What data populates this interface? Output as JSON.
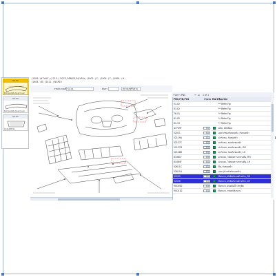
{
  "thumbnails": [
    {
      "label": "52-01",
      "caption": "Bumper&BumperCover",
      "selected": true
    },
    {
      "label": "52-02",
      "caption": "Bumper&BumperCover",
      "selected": false
    },
    {
      "label": "53-01",
      "caption": "Grille&Mldg",
      "selected": false
    }
  ],
  "header": {
    "line1": "(1306- )#7VHC ; (1713- ) 3GCC,GRN,P4,SA,VR,A ; (1902- ) C ; (1904- ) F ; (1909- ) H ;",
    "line2": "(1904- ) B ; (1411- ) NGP10"
  },
  "toolbar": {
    "illus_label": "ภาพประกอบที่",
    "illus_value": "52-01",
    "search_label": "ค้นหา",
    "pnc_label": "หมายเลขชิ้นส่วน"
  },
  "parts": {
    "header_label": "รายการ PNC",
    "pagination": "1 of 1",
    "columns": [
      "PNC,P/N,PCS",
      "จำนวน",
      "Mark",
      "ชื่ออะไหล่"
    ],
    "rows": [
      {
        "pnc": "51-02",
        "qty": "",
        "mark": false,
        "name": "** Refer Fig",
        "selected": false
      },
      {
        "pnc": "53-02",
        "qty": "",
        "mark": false,
        "name": "** Refer Fig",
        "selected": false
      },
      {
        "pnc": "76-01",
        "qty": "",
        "mark": false,
        "name": "** Refer Fig",
        "selected": false
      },
      {
        "pnc": "81-02",
        "qty": "",
        "mark": false,
        "name": "** Refer Fig",
        "selected": false
      },
      {
        "pnc": "81-19",
        "qty": "",
        "mark": false,
        "name": "** Refer Fig",
        "selected": false
      },
      {
        "pnc": "47749F",
        "qty": "01",
        "mark": true,
        "name": "คลิป, คลิปล็อค",
        "selected": false
      },
      {
        "pnc": "52021",
        "qty": "01",
        "mark": true,
        "name": "อุดปากช่องกันชนหลัง, กันชนหน้า",
        "selected": false
      },
      {
        "pnc": "52119A",
        "qty": "01",
        "mark": true,
        "name": "ฝากันชน, กันชนหน้า",
        "selected": false
      },
      {
        "pnc": "52127C",
        "qty": "01",
        "mark": true,
        "name": "ฝากันชน, ช่องกันชนหน้า",
        "selected": false
      },
      {
        "pnc": "52127D",
        "qty": "01",
        "mark": true,
        "name": "ฝากันชน, ช่องกันชนหน้า, RH",
        "selected": false
      },
      {
        "pnc": "52128B",
        "qty": "01",
        "mark": true,
        "name": "ฝากันชน, ช่องกันชนหน้า, LH",
        "selected": false
      },
      {
        "pnc": "81481F",
        "qty": "01",
        "mark": true,
        "name": "ฝาครอบ, ไฟส่องสว่างกลางคืน, RH",
        "selected": false
      },
      {
        "pnc": "81484F",
        "qty": "01",
        "mark": true,
        "name": "ฝาครอบ, ไฟส่องสว่างกลางคืน, LH",
        "selected": false
      },
      {
        "pnc": "52611C",
        "qty": "01",
        "mark": true,
        "name": "ยึด, กันชนหน้า",
        "selected": false
      },
      {
        "pnc": "52611A",
        "qty": "01",
        "mark": true,
        "name": "แผ่น (สำหรับกันชนหน้า)",
        "selected": false
      },
      {
        "pnc": "52535",
        "qty": "01",
        "mark": true,
        "name": "ยึดกลาง, ตัวยึดกันชนด้านข้าง, RH",
        "selected": true
      },
      {
        "pnc": "52536",
        "qty": "01",
        "mark": true,
        "name": "ยึดกลาง, ตัวยึดกันชนด้านข้าง, LH",
        "selected": true
      },
      {
        "pnc": "90C40D",
        "qty": "01",
        "mark": true,
        "name": "ยึดกลาง, ต่อหม้อน้ำ สกรูยึด",
        "selected": false
      },
      {
        "pnc": "90C41D",
        "qty": "01",
        "mark": true,
        "name": "ยึดกลาง, กลมสปริงกลาง",
        "selected": false
      }
    ]
  },
  "colors": {
    "accent": "#2f2fd8",
    "mark": "#1aa05a",
    "highlight_box": "#e03030"
  }
}
